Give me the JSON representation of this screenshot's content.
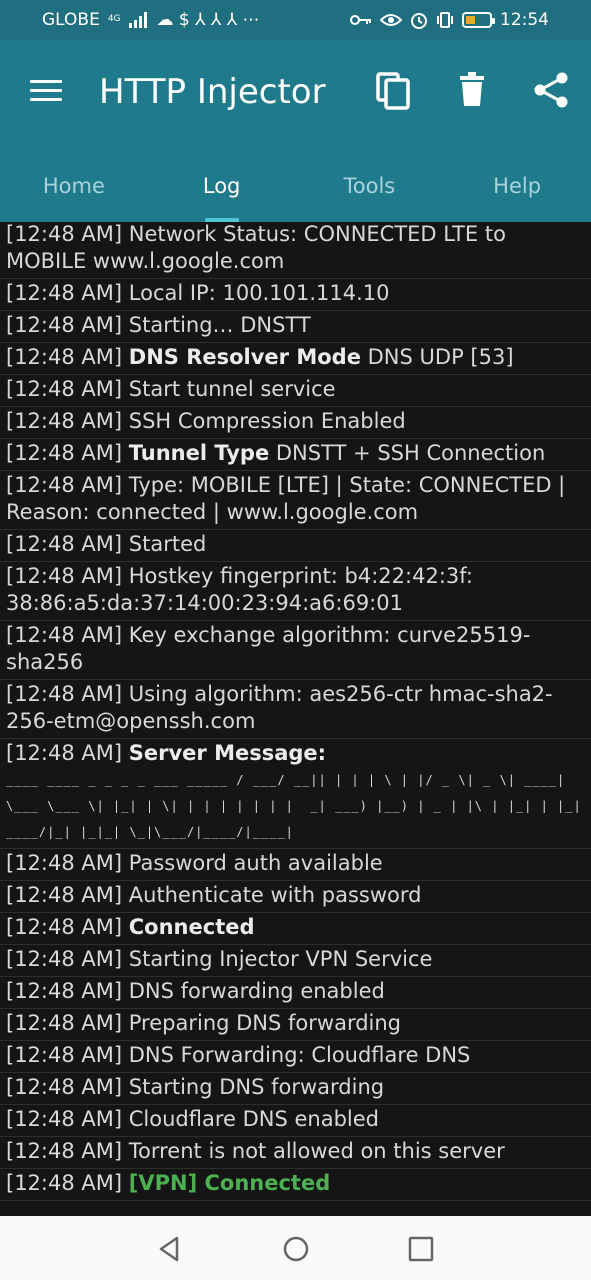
{
  "status_bar": {
    "carrier": "GLOBE",
    "network": "4G",
    "time": "12:54",
    "extra_icons": "☁ $ ⅄ ⅄ ⅄ ⋯"
  },
  "app_bar": {
    "title": "HTTP Injector"
  },
  "tabs": [
    {
      "label": "Home"
    },
    {
      "label": "Log"
    },
    {
      "label": "Tools"
    },
    {
      "label": "Help"
    }
  ],
  "log": [
    {
      "time": "[12:48 AM]",
      "bold": "",
      "text": "Network Status: CONNECTED LTE to MOBILE www.l.google.com"
    },
    {
      "time": "[12:48 AM]",
      "bold": "",
      "text": "Local IP: 100.101.114.10"
    },
    {
      "time": "[12:48 AM]",
      "bold": "",
      "text": "Starting… DNSTT"
    },
    {
      "time": "[12:48 AM]",
      "bold": "DNS Resolver Mode",
      "text": "DNS UDP [53]"
    },
    {
      "time": "[12:48 AM]",
      "bold": "",
      "text": "Start tunnel service"
    },
    {
      "time": "[12:48 AM]",
      "bold": "",
      "text": "SSH Compression Enabled"
    },
    {
      "time": "[12:48 AM]",
      "bold": "Tunnel Type",
      "text": "DNSTT + SSH Connection"
    },
    {
      "time": "[12:48 AM]",
      "bold": "",
      "text": "Type: MOBILE [LTE] | State: CONNECTED | Reason: connected | www.l.google.com"
    },
    {
      "time": "[12:48 AM]",
      "bold": "",
      "text": "Started"
    },
    {
      "time": "[12:48 AM]",
      "bold": "",
      "text": "Hostkey fingerprint: b4:22:42:3f: 38:86:a5:da:37:14:00:23:94:a6:69:01"
    },
    {
      "time": "[12:48 AM]",
      "bold": "",
      "text": "Key exchange algorithm: curve25519-sha256"
    },
    {
      "time": "[12:48 AM]",
      "bold": "",
      "text": "Using algorithm: aes256-ctr hmac-sha2-256-etm@openssh.com"
    },
    {
      "time": "[12:48 AM]",
      "bold": "Server Message:",
      "text": ""
    },
    {
      "time": "[12:48 AM]",
      "bold": "",
      "text": "Password auth available"
    },
    {
      "time": "[12:48 AM]",
      "bold": "",
      "text": "Authenticate with password"
    },
    {
      "time": "[12:48 AM]",
      "bold": "Connected",
      "text": ""
    },
    {
      "time": "[12:48 AM]",
      "bold": "",
      "text": "Starting Injector VPN Service"
    },
    {
      "time": "[12:48 AM]",
      "bold": "",
      "text": "DNS forwarding enabled"
    },
    {
      "time": "[12:48 AM]",
      "bold": "",
      "text": "Preparing DNS forwarding"
    },
    {
      "time": "[12:48 AM]",
      "bold": "",
      "text": "DNS Forwarding: Cloudflare DNS"
    },
    {
      "time": "[12:48 AM]",
      "bold": "",
      "text": "Starting DNS forwarding"
    },
    {
      "time": "[12:48 AM]",
      "bold": "",
      "text": "Cloudflare DNS enabled"
    },
    {
      "time": "[12:48 AM]",
      "bold": "",
      "text": "Torrent is not allowed on this server"
    },
    {
      "time": "[12:48 AM]",
      "green": "[VPN] Connected",
      "bold": "",
      "text": ""
    }
  ],
  "server_message_ascii": [
    "____ ____ _ _ _ _ ___ _____ / ___/ __|| | | | \\ | |/ _ \\| _ \\| ____|",
    "\\___ \\___ \\| |_| | \\| | | | | | | |  _| ___) |__) | _ | |\\ | |_| | |_| | |___ |____/",
    "____/|_| |_|_| \\_|\\___/|____/|____|"
  ],
  "icons": {
    "menu": "menu-icon",
    "copy": "copy-icon",
    "delete": "delete-icon",
    "share": "share-icon",
    "back": "back-icon",
    "home": "home-icon",
    "recents": "recents-icon"
  },
  "colors": {
    "primary": "#1f7a8c",
    "status_bar": "#1f6f80",
    "log_bg": "#151515",
    "green": "#4caf50",
    "tab_indicator": "#4fc3d7"
  }
}
